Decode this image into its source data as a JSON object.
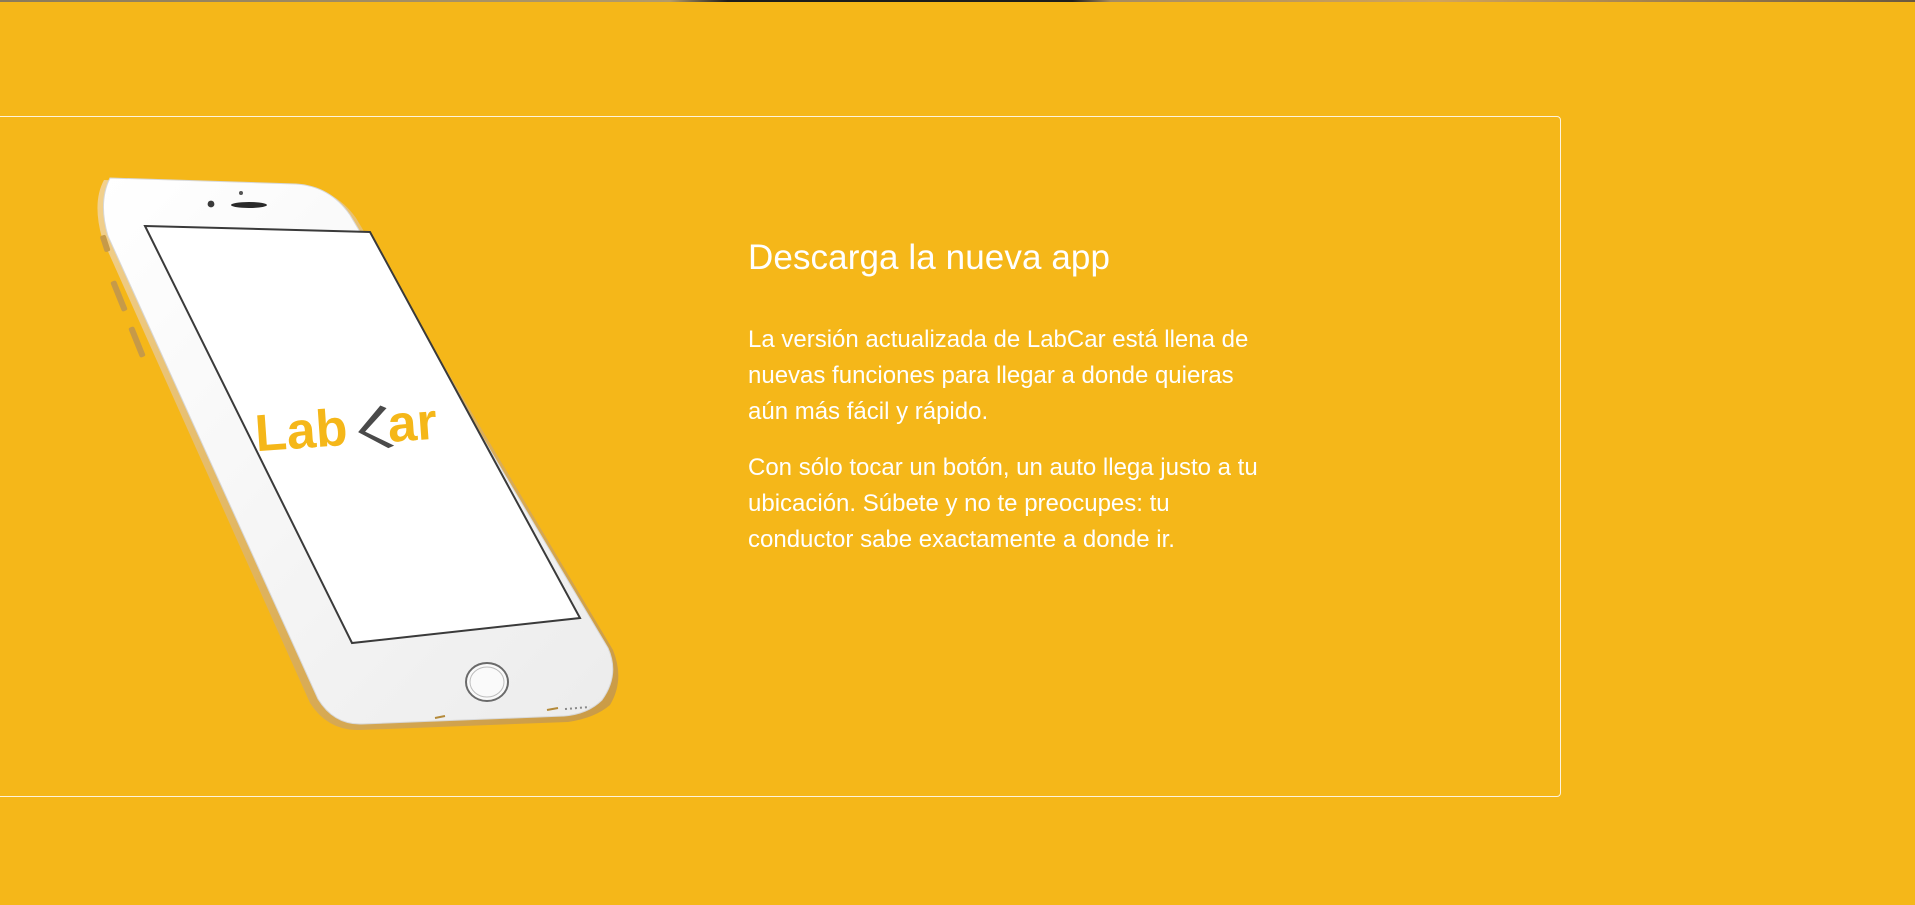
{
  "section": {
    "title": "Descarga la nueva app",
    "paragraphs": [
      "La versión actualizada de LabCar está llena de nuevas funciones para llegar a donde quieras aún más fácil y rápido.",
      "Con sólo tocar un botón, un auto llega justo a tu ubicación. Súbete y no te preocupes: tu conductor sabe exactamente a donde ir."
    ]
  },
  "phone": {
    "logo_left": "Lab",
    "logo_right": "ar",
    "brand_color": "#F5B719",
    "logo_mark_color": "#4a4a4a"
  },
  "colors": {
    "background": "#F5B719",
    "text": "#FFFFFF",
    "panel_border": "#FFFFFF",
    "phone_body": "#F4F4F4",
    "phone_edge": "#E2B760"
  }
}
